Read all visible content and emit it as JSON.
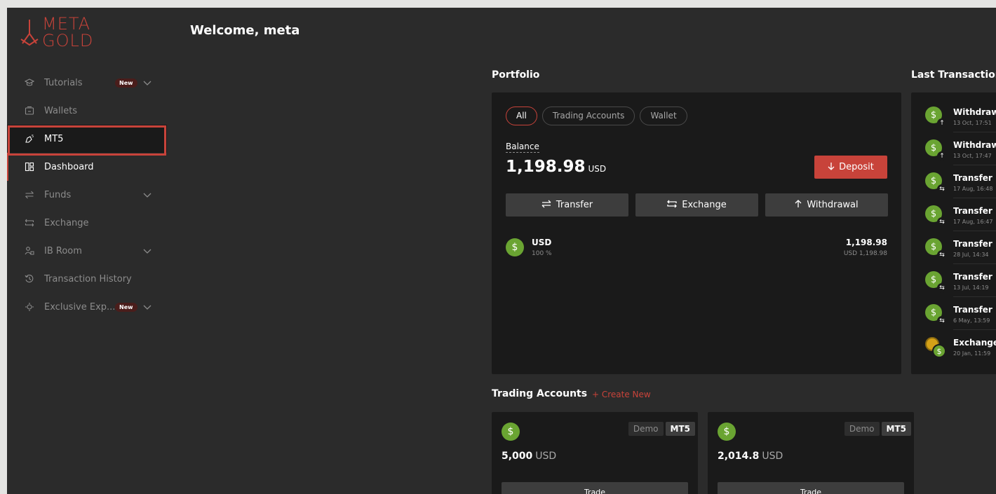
{
  "brand": {
    "line1": "META",
    "line2": "GOLD",
    "color": "#c8433a"
  },
  "header": {
    "welcome": "Welcome, meta"
  },
  "sidebar": {
    "items": [
      {
        "label": "Tutorials",
        "icon": "graduation-cap-icon",
        "badge": "New",
        "expandable": true
      },
      {
        "label": "Wallets",
        "icon": "wallet-icon"
      },
      {
        "label": "MT5",
        "icon": "mt5-icon",
        "selected": true
      },
      {
        "label": "Dashboard",
        "icon": "dashboard-icon",
        "active": true
      },
      {
        "label": "Funds",
        "icon": "transfer-icon",
        "expandable": true
      },
      {
        "label": "Exchange",
        "icon": "exchange-icon"
      },
      {
        "label": "IB Room",
        "icon": "users-icon",
        "expandable": true
      },
      {
        "label": "Transaction History",
        "icon": "history-icon"
      },
      {
        "label": "Exclusive Exp...",
        "icon": "exclusive-icon",
        "badge": "New",
        "expandable": true
      }
    ]
  },
  "portfolio": {
    "title": "Portfolio",
    "tabs": [
      "All",
      "Trading Accounts",
      "Wallet"
    ],
    "active_tab": "All",
    "balance_label": "Balance",
    "balance_value": "1,198.98",
    "balance_currency": "USD",
    "deposit_label": "Deposit",
    "actions": [
      "Transfer",
      "Exchange",
      "Withdrawal"
    ],
    "assets": [
      {
        "name": "USD",
        "percent": "100 %",
        "amount": "1,198.98",
        "sub": "USD 1,198.98"
      }
    ]
  },
  "transactions": {
    "title": "Last Transaction",
    "items": [
      {
        "type": "Withdrawa",
        "date": "13 Oct, 17:51",
        "kind": "withdraw"
      },
      {
        "type": "Withdrawa",
        "date": "13 Oct, 17:47",
        "kind": "withdraw"
      },
      {
        "type": "Transfer",
        "date": "17 Aug, 16:48",
        "kind": "transfer"
      },
      {
        "type": "Transfer",
        "date": "17 Aug, 16:47",
        "kind": "transfer"
      },
      {
        "type": "Transfer",
        "date": "28 Jul, 14:34",
        "kind": "transfer"
      },
      {
        "type": "Transfer",
        "date": "13 Jul, 14:19",
        "kind": "transfer"
      },
      {
        "type": "Transfer",
        "date": "6 May, 13:59",
        "kind": "transfer"
      },
      {
        "type": "Exchange",
        "date": "20 Jan, 11:59",
        "kind": "exchange"
      }
    ]
  },
  "trading_accounts": {
    "title": "Trading Accounts",
    "create_label": "+ Create New",
    "accounts": [
      {
        "type": "Demo",
        "platform": "MT5",
        "amount": "5,000",
        "currency": "USD",
        "trade_label": "Trade"
      },
      {
        "type": "Demo",
        "platform": "MT5",
        "amount": "2,014.8",
        "currency": "USD",
        "trade_label": "Trade"
      }
    ]
  }
}
